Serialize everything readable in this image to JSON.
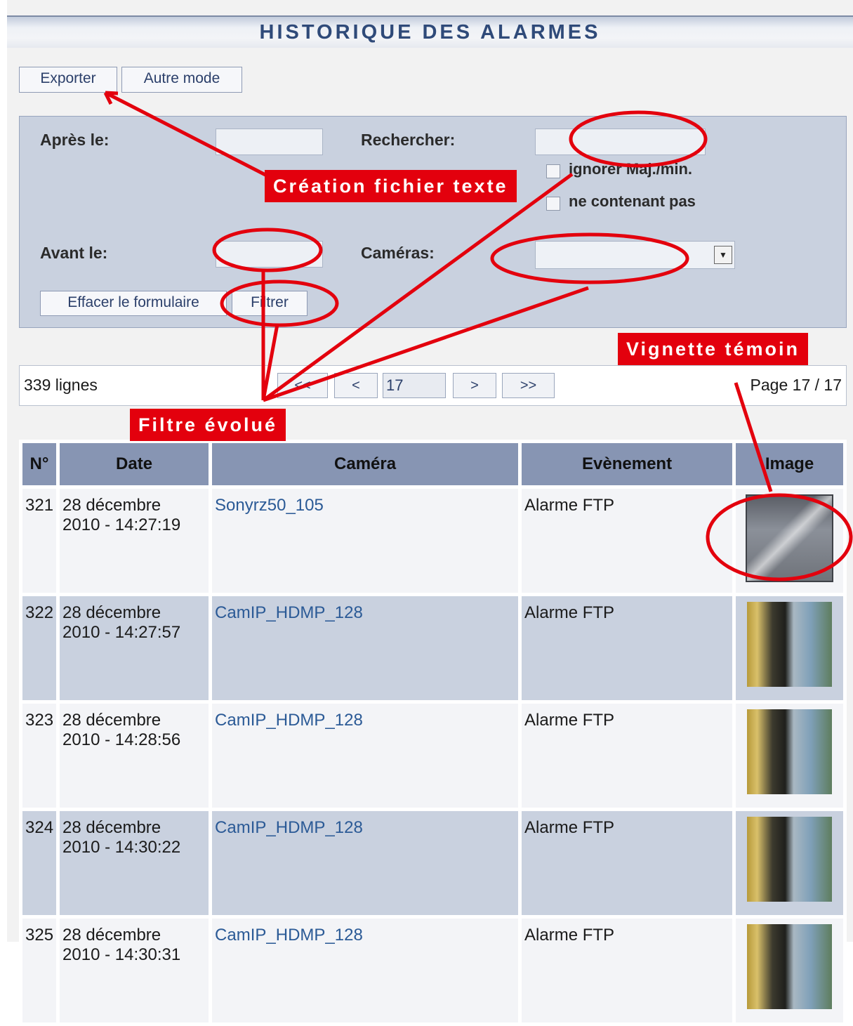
{
  "page": {
    "title": "HISTORIQUE DES ALARMES"
  },
  "toolbar": {
    "export_label": "Exporter",
    "other_mode_label": "Autre mode"
  },
  "filter": {
    "after_label": "Après le:",
    "before_label": "Avant le:",
    "search_label": "Rechercher:",
    "ignore_case_label": "ignorer Maj./min.",
    "not_containing_label": "ne contenant pas",
    "cameras_label": "Caméras:",
    "clear_label": "Effacer le formulaire",
    "filter_label": "Filtrer"
  },
  "pager": {
    "count": "339 lignes",
    "first": "<<",
    "prev": "<",
    "current": "17",
    "next": ">",
    "last": ">>",
    "page_label": "Page 17 / 17"
  },
  "table": {
    "headers": [
      "N°",
      "Date",
      "Caméra",
      "Evènement",
      "Image"
    ],
    "rows": [
      {
        "n": "321",
        "date_line1": "28 décembre",
        "date_line2": "2010 - 14:27:19",
        "camera": "Sonyrz50_105",
        "event": "Alarme FTP"
      },
      {
        "n": "322",
        "date_line1": "28 décembre",
        "date_line2": "2010 - 14:27:57",
        "camera": "CamIP_HDMP_128",
        "event": "Alarme FTP"
      },
      {
        "n": "323",
        "date_line1": "28 décembre",
        "date_line2": "2010 - 14:28:56",
        "camera": "CamIP_HDMP_128",
        "event": "Alarme FTP"
      },
      {
        "n": "324",
        "date_line1": "28 décembre",
        "date_line2": "2010 - 14:30:22",
        "camera": "CamIP_HDMP_128",
        "event": "Alarme FTP"
      },
      {
        "n": "325",
        "date_line1": "28 décembre",
        "date_line2": "2010 - 14:30:31",
        "camera": "CamIP_HDMP_128",
        "event": "Alarme FTP"
      }
    ]
  },
  "annotations": {
    "text_file": "Création fichier texte",
    "thumbnail": "Vignette témoin",
    "filter": "Filtre évolué",
    "color": "#e3000d"
  }
}
